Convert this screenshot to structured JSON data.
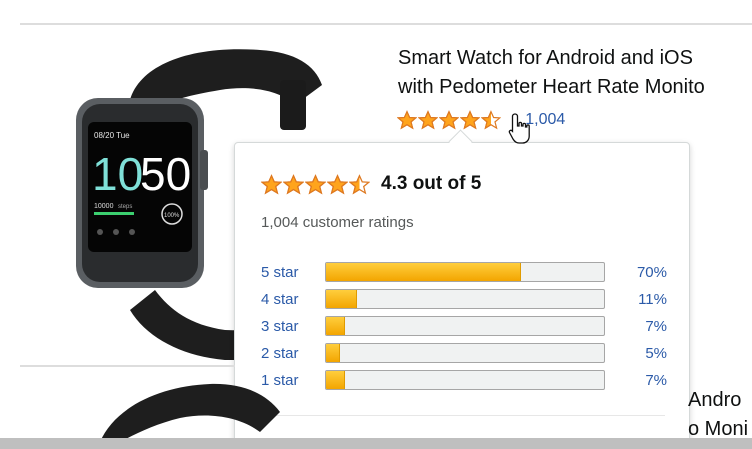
{
  "product": {
    "title_line1": "Smart Watch for Android and iOS",
    "title_line2": "with Pedometer Heart Rate Monito",
    "rating_stars": 4.3,
    "ratings_count_link": "1,004",
    "screen": {
      "date": "08/20 Tue",
      "time_hours": "10",
      "time_minutes": "50",
      "steps": "10000",
      "steps_unit": "steps",
      "progress": "100%"
    }
  },
  "popover": {
    "score_text": "4.3 out of 5",
    "total_text": "1,004 customer ratings",
    "histogram": [
      {
        "label": "5 star",
        "percent_text": "70%",
        "fraction": 0.7
      },
      {
        "label": "4 star",
        "percent_text": "11%",
        "fraction": 0.11
      },
      {
        "label": "3 star",
        "percent_text": "7%",
        "fraction": 0.07
      },
      {
        "label": "2 star",
        "percent_text": "5%",
        "fraction": 0.05
      },
      {
        "label": "1 star",
        "percent_text": "7%",
        "fraction": 0.07
      }
    ]
  },
  "next_product": {
    "title_line1": "Andro",
    "title_line2": "o Moni"
  },
  "colors": {
    "star": "#ffa41c",
    "link": "#2b5aa8",
    "bar_fill": "#f3a500"
  },
  "icons": [
    "star-icon",
    "half-star-icon",
    "chevron-down-icon",
    "hand-pointer-cursor-icon"
  ]
}
